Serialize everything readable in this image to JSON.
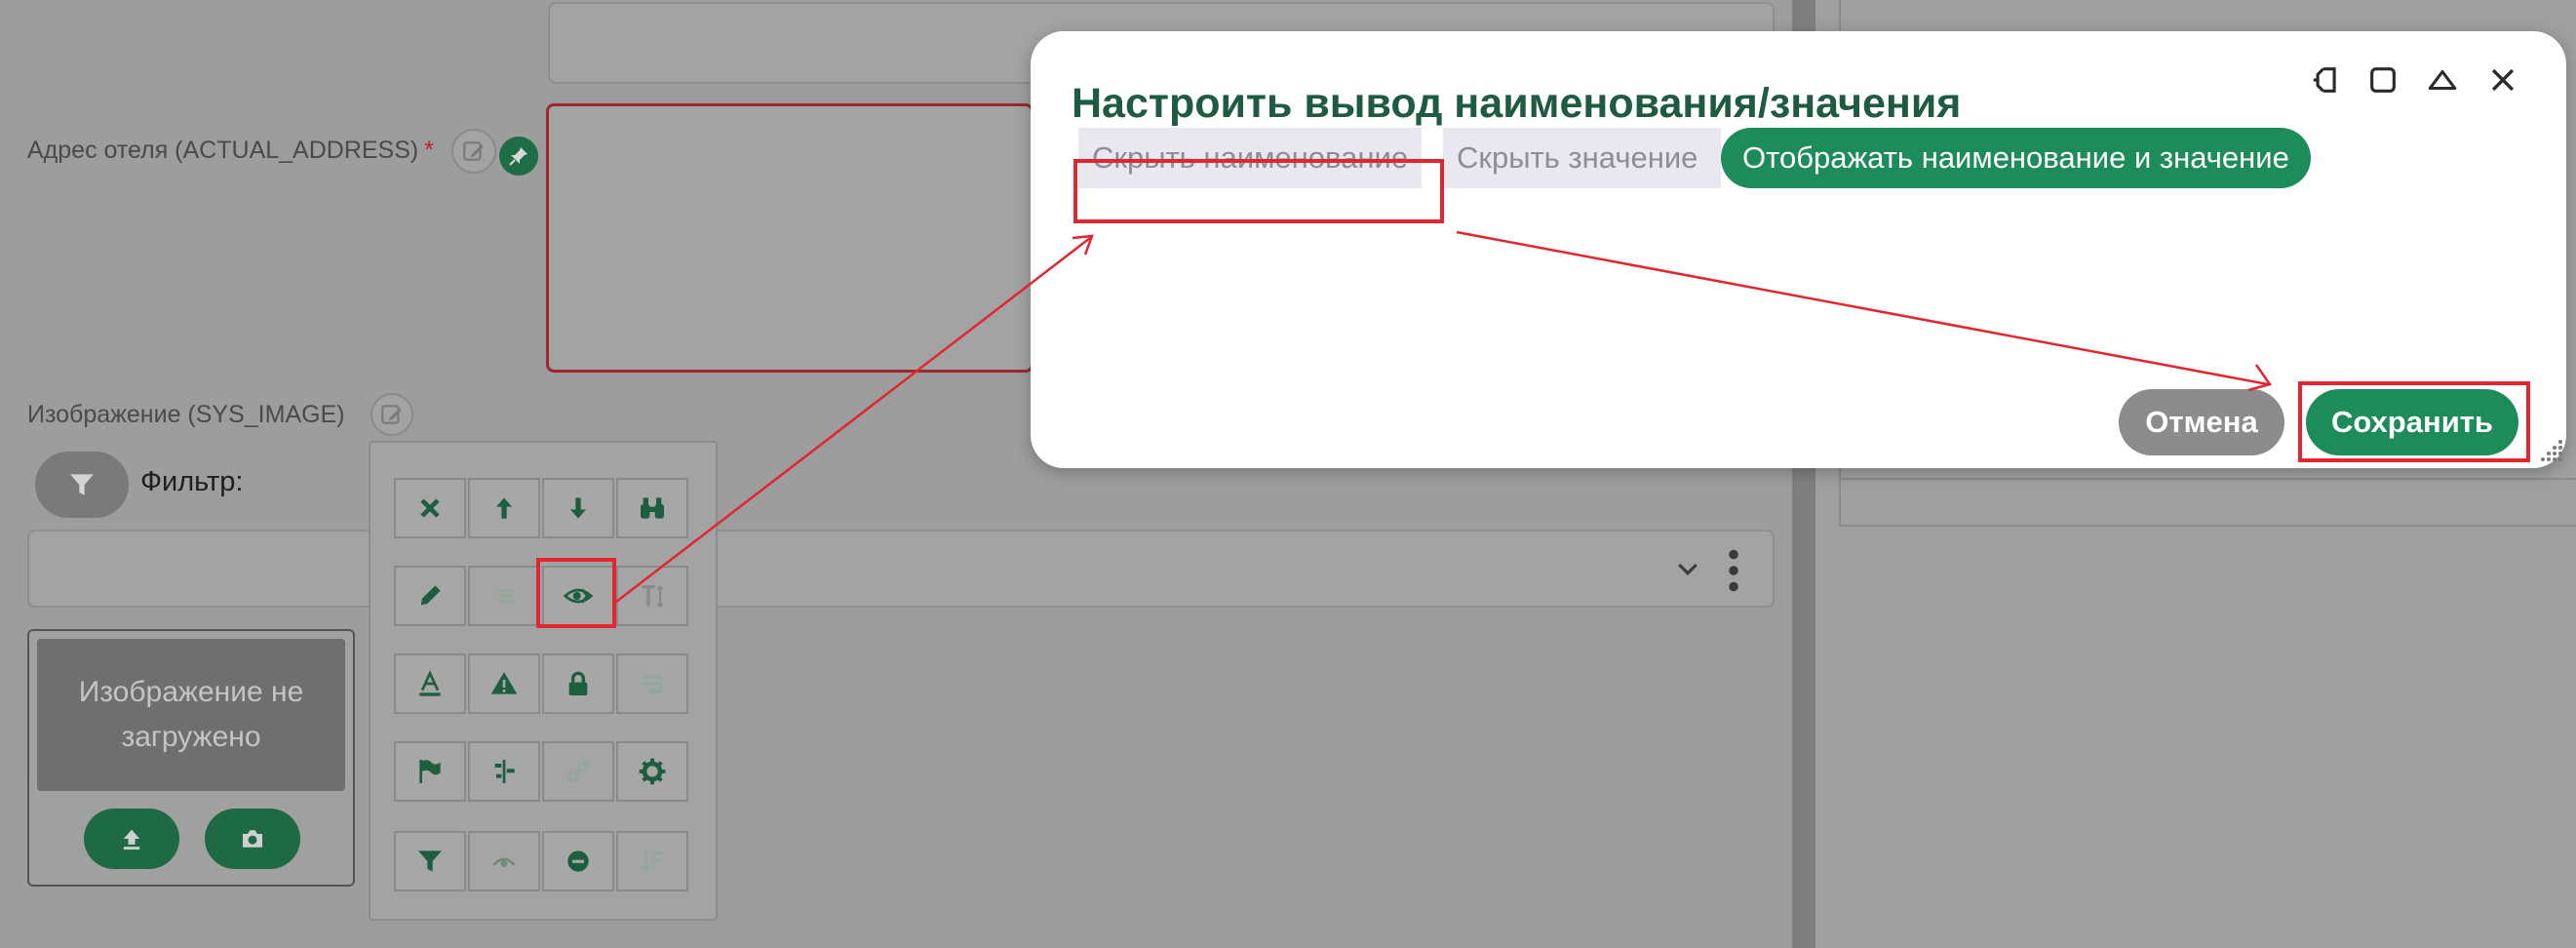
{
  "form": {
    "address_label": "Адрес отеля (ACTUAL_ADDRESS)",
    "required_mark": "*",
    "image_label": "Изображение (SYS_IMAGE)",
    "filter_label": "Фильтр:",
    "image_placeholder": "Изображение не загружено",
    "upload_icon": "upload-icon",
    "camera_icon": "camera-icon"
  },
  "toolbar": {
    "rows": [
      [
        "close-icon",
        "arrow-up-icon",
        "arrow-down-icon",
        "binoculars-icon"
      ],
      [
        "pencil-icon",
        "list-icon",
        "eye-code-icon",
        "text-height-icon"
      ],
      [
        "font-color-icon",
        "warning-icon",
        "lock-icon",
        "wrap-icon"
      ],
      [
        "flag-icon",
        "align-icon",
        "link-icon",
        "gear-icon"
      ],
      [
        "filter-icon",
        "view-icon",
        "minus-circle-icon",
        "sort-icon"
      ]
    ]
  },
  "modal": {
    "title": "Настроить вывод наименования/значения",
    "options": [
      "Скрыть наименование",
      "Скрыть значение",
      "Отображать наименование и значение"
    ],
    "selected_option": "Отображать наименование и значение",
    "cancel_label": "Отмена",
    "save_label": "Сохранить",
    "window_icons": [
      "pin-icon",
      "maximize-icon",
      "collapse-icon",
      "close-icon"
    ]
  },
  "colors": {
    "accent": "#1e8c5a",
    "title": "#1f5a43",
    "highlight": "#e0262f",
    "overlay": "#9d9d9d"
  }
}
